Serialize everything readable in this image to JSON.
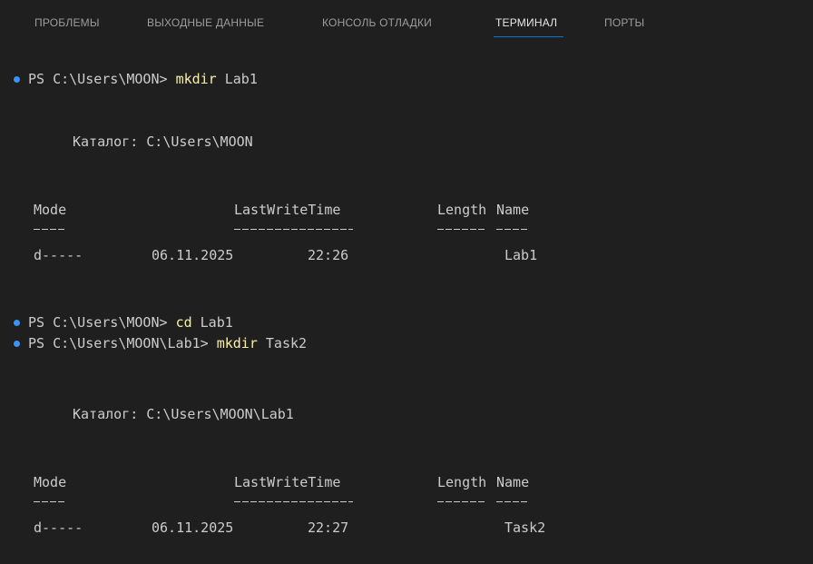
{
  "panel": {
    "tabs": [
      {
        "label": "ПРОБЛЕМЫ"
      },
      {
        "label": "ВЫХОДНЫЕ ДАННЫЕ"
      },
      {
        "label": "КОНСОЛЬ ОТЛАДКИ"
      },
      {
        "label": "ТЕРМИНАЛ"
      },
      {
        "label": "ПОРТЫ"
      }
    ],
    "active_tab": "ТЕРМИНАЛ"
  },
  "terminal": {
    "commands": [
      {
        "prompt": "PS C:\\Users\\MOON> ",
        "cmd": "mkdir",
        "args": " Lab1"
      },
      {
        "prompt": "PS C:\\Users\\MOON> ",
        "cmd": "cd",
        "args": " Lab1"
      },
      {
        "prompt": "PS C:\\Users\\MOON\\Lab1> ",
        "cmd": "mkdir",
        "args": " Task2"
      }
    ],
    "listings": [
      {
        "directory_line": "Каталог: C:\\Users\\MOON",
        "headers": {
          "mode": "Mode",
          "lastwritetime": "LastWriteTime",
          "length": "Length",
          "name": "Name"
        },
        "row": {
          "mode": "d-----",
          "date": "06.11.2025",
          "time": "22:26",
          "name": "Lab1"
        }
      },
      {
        "directory_line": "Каталог: C:\\Users\\MOON\\Lab1",
        "headers": {
          "mode": "Mode",
          "lastwritetime": "LastWriteTime",
          "length": "Length",
          "name": "Name"
        },
        "row": {
          "mode": "d-----",
          "date": "06.11.2025",
          "time": "22:27",
          "name": "Task2"
        }
      }
    ]
  },
  "colors": {
    "background": "#1f1f1f",
    "text": "#cccccc",
    "command": "#f9f1a5",
    "prompt_dot": "#3794ff",
    "active_tab_underline": "#0078d4"
  }
}
